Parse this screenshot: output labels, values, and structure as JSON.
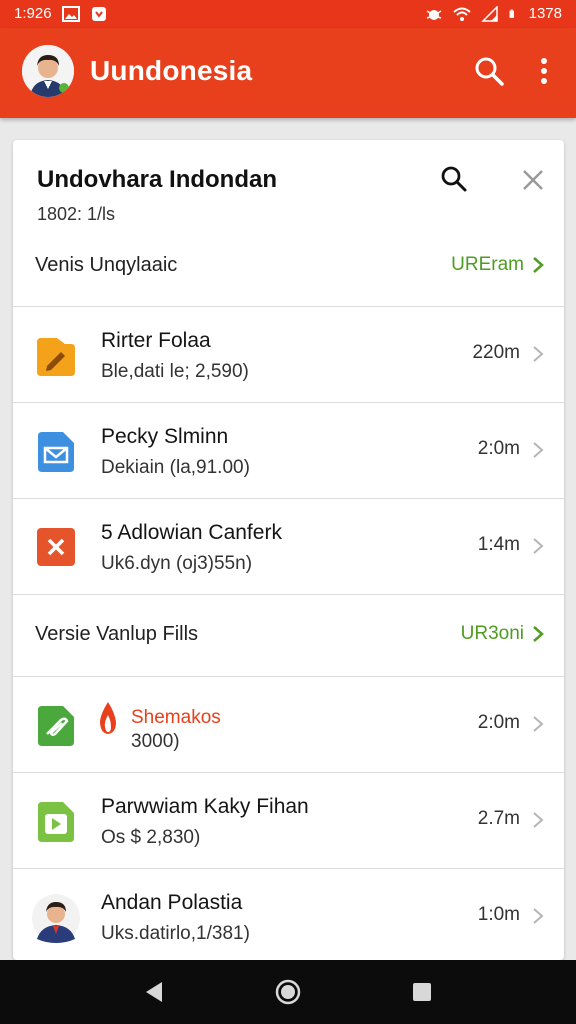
{
  "status_bar": {
    "time": "1:926",
    "right_text": "1378"
  },
  "app_bar": {
    "title": "Uundonesia"
  },
  "card": {
    "title": "Undovhara Indondan",
    "subtitle": "1802: 1/ls",
    "section1": {
      "label": "Venis Unqylaaic",
      "link": "UREram"
    },
    "section2": {
      "label": "Versie Vanlup Fills",
      "link": "UR3oni"
    },
    "items": [
      {
        "name": "Rirter Folaa",
        "meta": "Ble,dati le; 2,590)",
        "size": "220m",
        "icon": "folder-edit-icon",
        "color": "#f3a21a"
      },
      {
        "name": "Pecky Slminn",
        "meta": "Dekiain (la,91.00)",
        "size": "2:0m",
        "icon": "mail-document-icon",
        "color": "#3d8fe0"
      },
      {
        "name": "5 Adlowian Canferk",
        "meta": "Uk6.dyn (oj3)55n)",
        "size": "1:4m",
        "icon": "close-box-icon",
        "color": "#e6542c"
      },
      {
        "name": "Shemakos",
        "meta": "3000)",
        "size": "2:0m",
        "icon": "attachment-document-icon",
        "color": "#4aa83c"
      },
      {
        "name": "Parwwiam Kaky Fihan",
        "meta": "Os $ 2,830)",
        "size": "2.7m",
        "icon": "play-document-icon",
        "color": "#7bc142"
      },
      {
        "name": "Andan Polastia",
        "meta": "Uks.datirlo,1/381)",
        "size": "1:0m",
        "icon": "person-avatar-icon",
        "color": "#2a3d7a"
      }
    ]
  },
  "colors": {
    "accent": "#e8401c",
    "link_green": "#4f9c22",
    "nav_bg": "#0c0c0c"
  }
}
